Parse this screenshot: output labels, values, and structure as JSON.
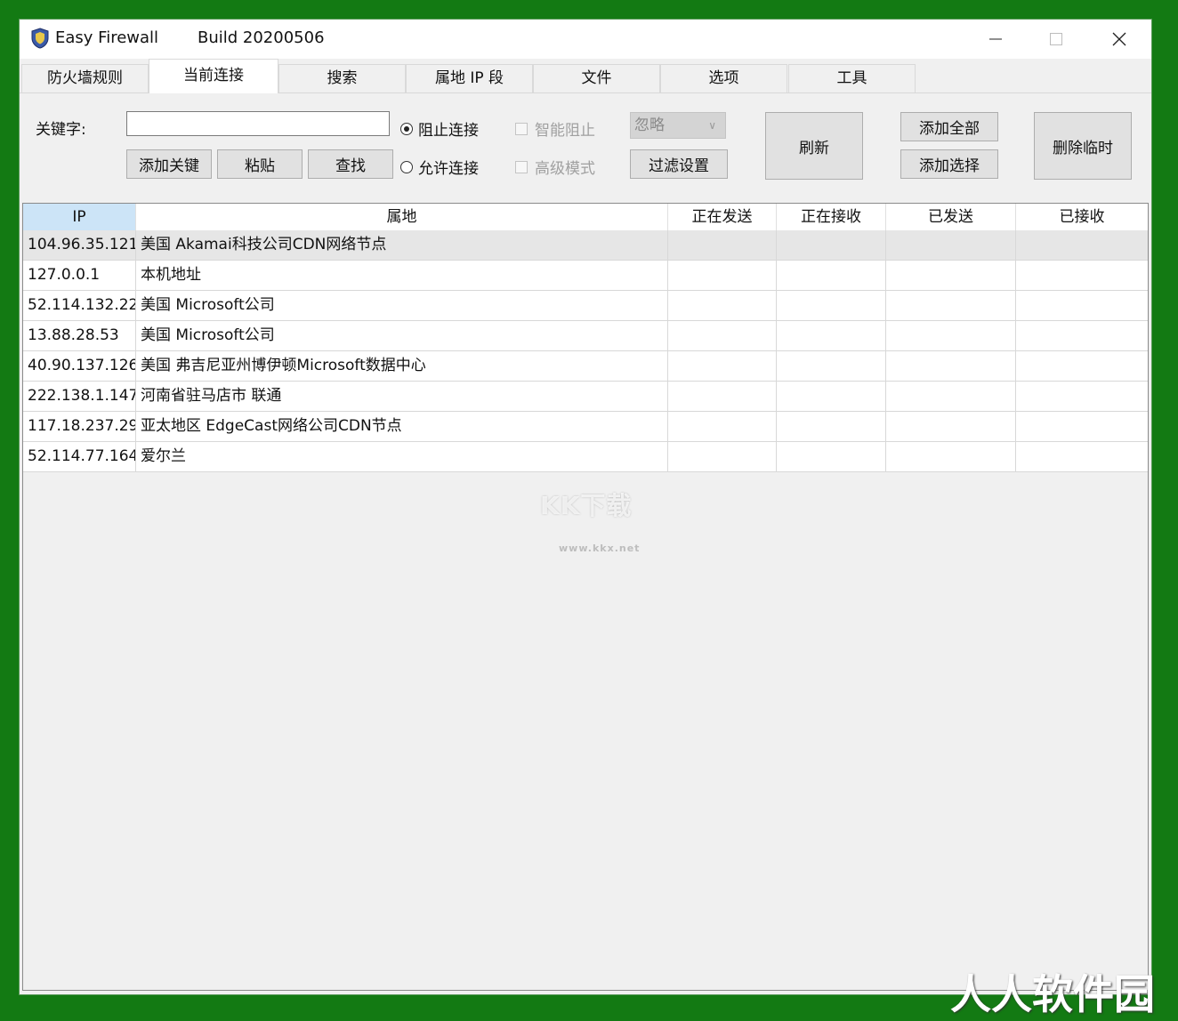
{
  "colors": {
    "background": "#137a13",
    "window": "#f0f0f0",
    "header_selected": "#cce4f7",
    "row_selected": "#e6e6e6"
  },
  "window": {
    "title": "Easy Firewall",
    "build": "Build 20200506",
    "icon": "shield-icon"
  },
  "tabs": [
    "防火墙规则",
    "当前连接",
    "搜索",
    "属地 IP 段",
    "文件",
    "选项",
    "工具"
  ],
  "active_tab": "当前连接",
  "toolbar": {
    "keyword_label": "关键字:",
    "keyword_value": "",
    "add_keyword": "添加关键",
    "paste": "粘贴",
    "find": "查找",
    "block_conn": "阻止连接",
    "allow_conn": "允许连接",
    "smart_block": "智能阻止",
    "advanced_mode": "高级模式",
    "ignore_select": "忽略",
    "filter_settings": "过滤设置",
    "refresh": "刷新",
    "add_all": "添加全部",
    "add_selected": "添加选择",
    "delete_temp": "删除临时"
  },
  "table": {
    "columns": [
      "IP",
      "属地",
      "正在发送",
      "正在接收",
      "已发送",
      "已接收"
    ],
    "rows": [
      [
        "104.96.35.121",
        "美国 Akamai科技公司CDN网络节点",
        "",
        "",
        "",
        ""
      ],
      [
        "127.0.0.1",
        "本机地址",
        "",
        "",
        "",
        ""
      ],
      [
        "52.114.132.22",
        "美国 Microsoft公司",
        "",
        "",
        "",
        ""
      ],
      [
        "13.88.28.53",
        "美国 Microsoft公司",
        "",
        "",
        "",
        ""
      ],
      [
        "40.90.137.126",
        "美国 弗吉尼亚州博伊顿Microsoft数据中心",
        "",
        "",
        "",
        ""
      ],
      [
        "222.138.1.147",
        "河南省驻马店市 联通",
        "",
        "",
        "",
        ""
      ],
      [
        "117.18.237.29",
        "亚太地区 EdgeCast网络公司CDN节点",
        "",
        "",
        "",
        ""
      ],
      [
        "52.114.77.164",
        "爱尔兰",
        "",
        "",
        "",
        ""
      ]
    ]
  },
  "watermarks": {
    "center": "KK下载",
    "center_url": "www.kkx.net",
    "corner": "人人软件园"
  }
}
